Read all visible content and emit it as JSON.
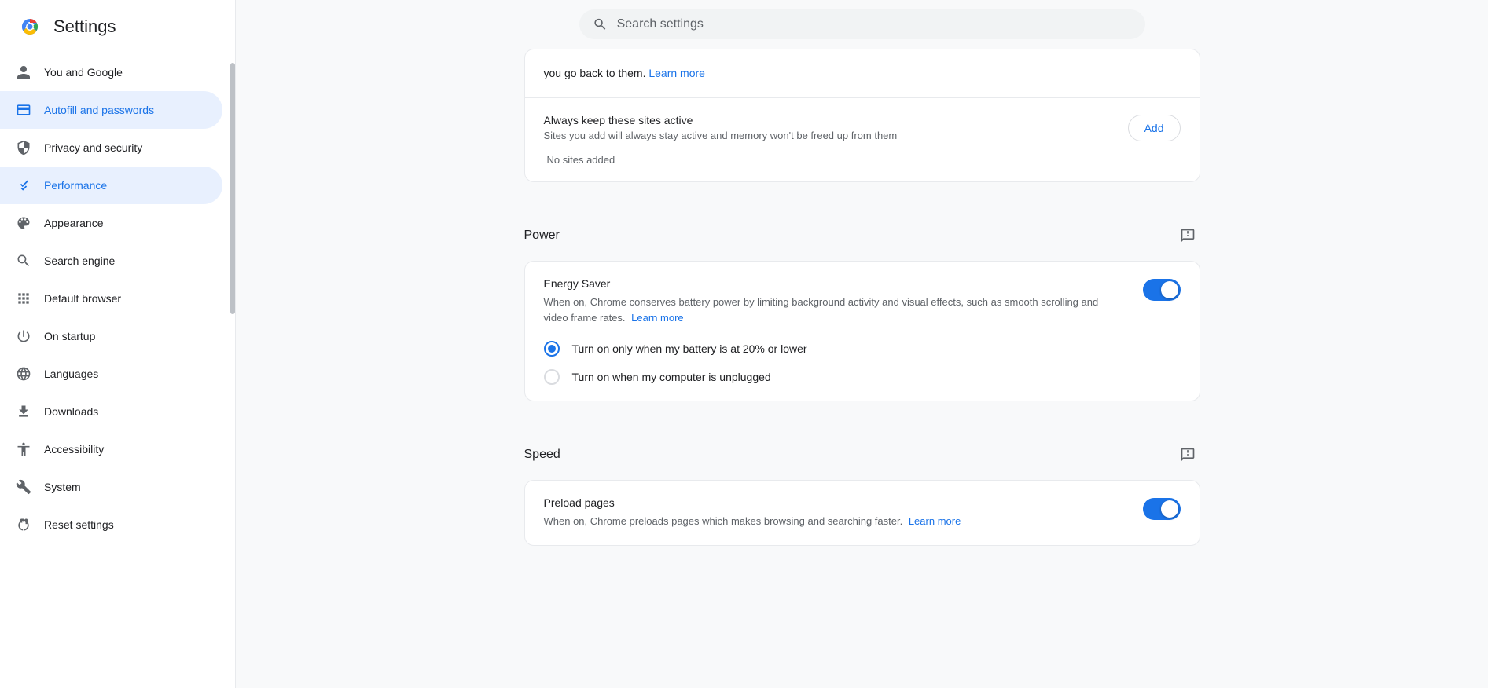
{
  "app": {
    "title": "Settings",
    "search_placeholder": "Search settings"
  },
  "sidebar": {
    "items": [
      {
        "id": "you-and-google",
        "label": "You and Google",
        "icon": "person"
      },
      {
        "id": "autofill-and-passwords",
        "label": "Autofill and passwords",
        "icon": "autofill",
        "active": true
      },
      {
        "id": "privacy-and-security",
        "label": "Privacy and security",
        "icon": "shield"
      },
      {
        "id": "performance",
        "label": "Performance",
        "icon": "performance",
        "current": true
      },
      {
        "id": "appearance",
        "label": "Appearance",
        "icon": "appearance"
      },
      {
        "id": "search-engine",
        "label": "Search engine",
        "icon": "search"
      },
      {
        "id": "default-browser",
        "label": "Default browser",
        "icon": "browser"
      },
      {
        "id": "on-startup",
        "label": "On startup",
        "icon": "startup"
      },
      {
        "id": "languages",
        "label": "Languages",
        "icon": "language"
      },
      {
        "id": "downloads",
        "label": "Downloads",
        "icon": "download"
      },
      {
        "id": "accessibility",
        "label": "Accessibility",
        "icon": "accessibility"
      },
      {
        "id": "system",
        "label": "System",
        "icon": "system"
      },
      {
        "id": "reset-settings",
        "label": "Reset settings",
        "icon": "reset"
      }
    ]
  },
  "main": {
    "always_active": {
      "intro_text": "you go back to them.",
      "intro_link_text": "Learn more",
      "title": "Always keep these sites active",
      "description": "Sites you add will always stay active and memory won't be freed up from them",
      "add_button_label": "Add",
      "no_sites_text": "No sites added"
    },
    "power_section": {
      "title": "Power",
      "energy_saver": {
        "title": "Energy Saver",
        "description": "When on, Chrome conserves battery power by limiting background activity and visual effects, such as smooth scrolling and video frame rates.",
        "learn_more_text": "Learn more",
        "enabled": true,
        "options": [
          {
            "id": "battery-20",
            "label": "Turn on only when my battery is at 20% or lower",
            "selected": true
          },
          {
            "id": "unplugged",
            "label": "Turn on when my computer is unplugged",
            "selected": false
          }
        ]
      }
    },
    "speed_section": {
      "title": "Speed",
      "preload_pages": {
        "title": "Preload pages",
        "description": "When on, Chrome preloads pages which makes browsing and searching faster.",
        "learn_more_text": "Learn more",
        "enabled": true
      }
    }
  }
}
